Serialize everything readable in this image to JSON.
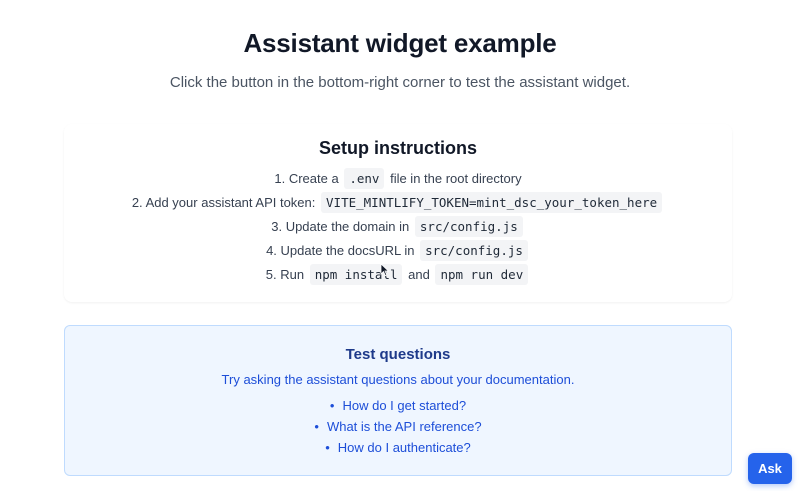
{
  "page": {
    "title": "Assistant widget example",
    "subtitle": "Click the button in the bottom-right corner to test the assistant widget."
  },
  "setup": {
    "title": "Setup instructions",
    "steps": [
      {
        "prefix": "1. Create a",
        "code": ".env",
        "suffix": "file in the root directory"
      },
      {
        "prefix": "2. Add your assistant API token:",
        "code": "VITE_MINTLIFY_TOKEN=mint_dsc_your_token_here"
      },
      {
        "prefix": "3. Update the domain in",
        "code": "src/config.js"
      },
      {
        "prefix": "4. Update the docsURL in",
        "code": "src/config.js"
      },
      {
        "prefix": "5. Run",
        "code": "npm install",
        "middle": "and",
        "code2": "npm run dev"
      }
    ]
  },
  "test": {
    "title": "Test questions",
    "description": "Try asking the assistant questions about your documentation.",
    "questions": [
      "How do I get started?",
      "What is the API reference?",
      "How do I authenticate?"
    ]
  },
  "widget": {
    "ask_label": "Ask"
  },
  "colors": {
    "accent": "#2563eb",
    "info_bg": "#eff6ff",
    "info_border": "#bfdbfe",
    "info_title": "#1e3a8a",
    "info_text": "#1d4ed8"
  }
}
